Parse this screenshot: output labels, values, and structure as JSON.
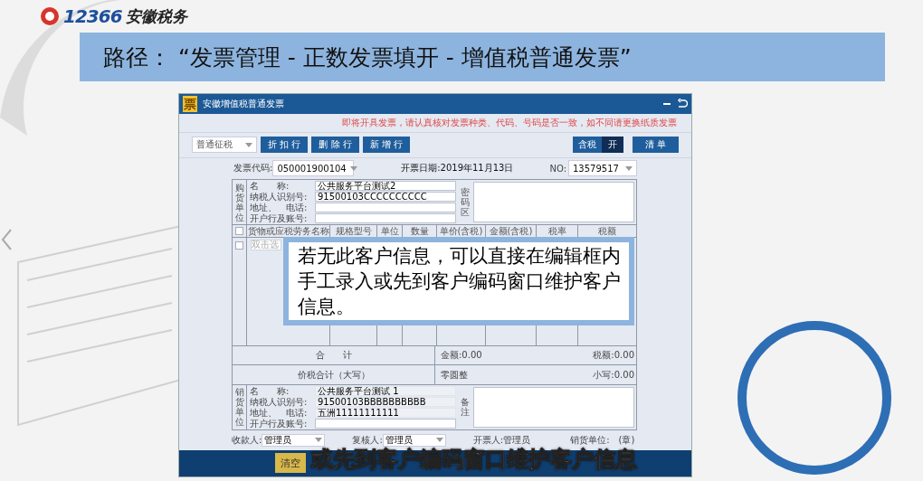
{
  "brand": {
    "logo_number": "12366",
    "name": "安徽税务"
  },
  "path_banner": "路径：  “发票管理 - 正数发票填开 - 增值税普通发票”",
  "window": {
    "icon_glyph": "票",
    "title": "安徽增值税普通发票",
    "notice": "即将开具发票，请认真核对发票种类、代码、号码是否一致，如不同请更换纸质发票"
  },
  "toolbar": {
    "tax_mode": "普通征税",
    "buttons": [
      "折 扣 行",
      "删 除 行",
      "新 增 行"
    ],
    "tax_toggle": {
      "label": "含税",
      "state": "开",
      "on": true
    },
    "list_button": "清 单"
  },
  "header": {
    "code_label": "发票代码:",
    "code": "050001900104",
    "date": "开票日期:2019年11月13日",
    "no_label": "NO:",
    "no": "13579517"
  },
  "buyer": {
    "side_label": "购货单位",
    "fields": [
      {
        "label": "名　　称:",
        "value": "公共服务平台测试2"
      },
      {
        "label": "纳税人识别号:",
        "value": "91500103CCCCCCCCCC"
      },
      {
        "label": "地址、　电话:"
      },
      {
        "label": "开户行及账号:"
      }
    ],
    "cipher_label": "密码区"
  },
  "items": {
    "select_all_checked": false,
    "columns": [
      "货物或应税劳务名称",
      "规格型号",
      "单位",
      "数量",
      "单价(含税)",
      "金额(含税)",
      "税率",
      "税额"
    ],
    "rows": [
      {
        "checked": false,
        "placeholder": "双击选"
      }
    ]
  },
  "totals": {
    "label": "合　　计",
    "amount": "金额:0.00",
    "tax": "税额:0.00"
  },
  "grand_total": {
    "label": "价税合计（大写）",
    "words": "零圆整",
    "figure": "小写:0.00"
  },
  "seller": {
    "side_label": "销货单位",
    "fields": [
      {
        "label": "名　　称:",
        "value": "公共服务平台测试 1",
        "editable": false
      },
      {
        "label": "纳税人识别号:",
        "value": "91500103BBBBBBBBBB",
        "editable": false
      },
      {
        "label": "地址、　电话:",
        "value": "五洲11111111111",
        "editable": false
      },
      {
        "label": "开户行及账号:",
        "editable": true
      }
    ],
    "remarks_label": "备注"
  },
  "signers": {
    "payee_label": "收款人:",
    "payee": "管理员",
    "reviewer_label": "复核人:",
    "reviewer": "管理员",
    "drawer": "开票人:管理员",
    "seal": "销货单位:　(章)"
  },
  "footer_buttons": [
    "清空"
  ],
  "callout": "若无此客户信息，可以直接在编辑框内手工录入或先到客户编码窗口维护客户信息。",
  "subtitle": "或先到客户编码窗口维护客户信息"
}
